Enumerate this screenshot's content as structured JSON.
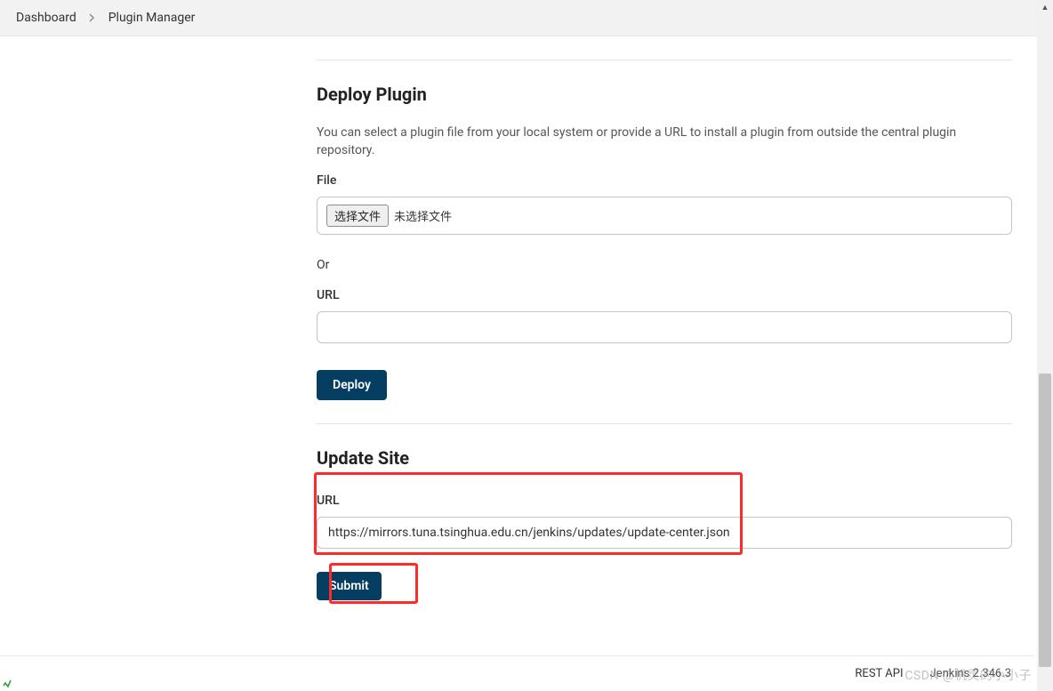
{
  "breadcrumb": {
    "items": [
      "Dashboard",
      "Plugin Manager"
    ]
  },
  "deploy": {
    "title": "Deploy Plugin",
    "description": "You can select a plugin file from your local system or provide a URL to install a plugin from outside the central plugin repository.",
    "file_label": "File",
    "file_button": "选择文件",
    "file_status": "未选择文件",
    "or_label": "Or",
    "url_label": "URL",
    "url_value": "",
    "deploy_button": "Deploy"
  },
  "update_site": {
    "title": "Update Site",
    "url_label": "URL",
    "url_value": "https://mirrors.tuna.tsinghua.edu.cn/jenkins/updates/update-center.json",
    "submit_button": "Submit"
  },
  "footer": {
    "rest_api": "REST API",
    "version": "Jenkins 2.346.3"
  },
  "watermark": "CSDN @机灵的小小子"
}
